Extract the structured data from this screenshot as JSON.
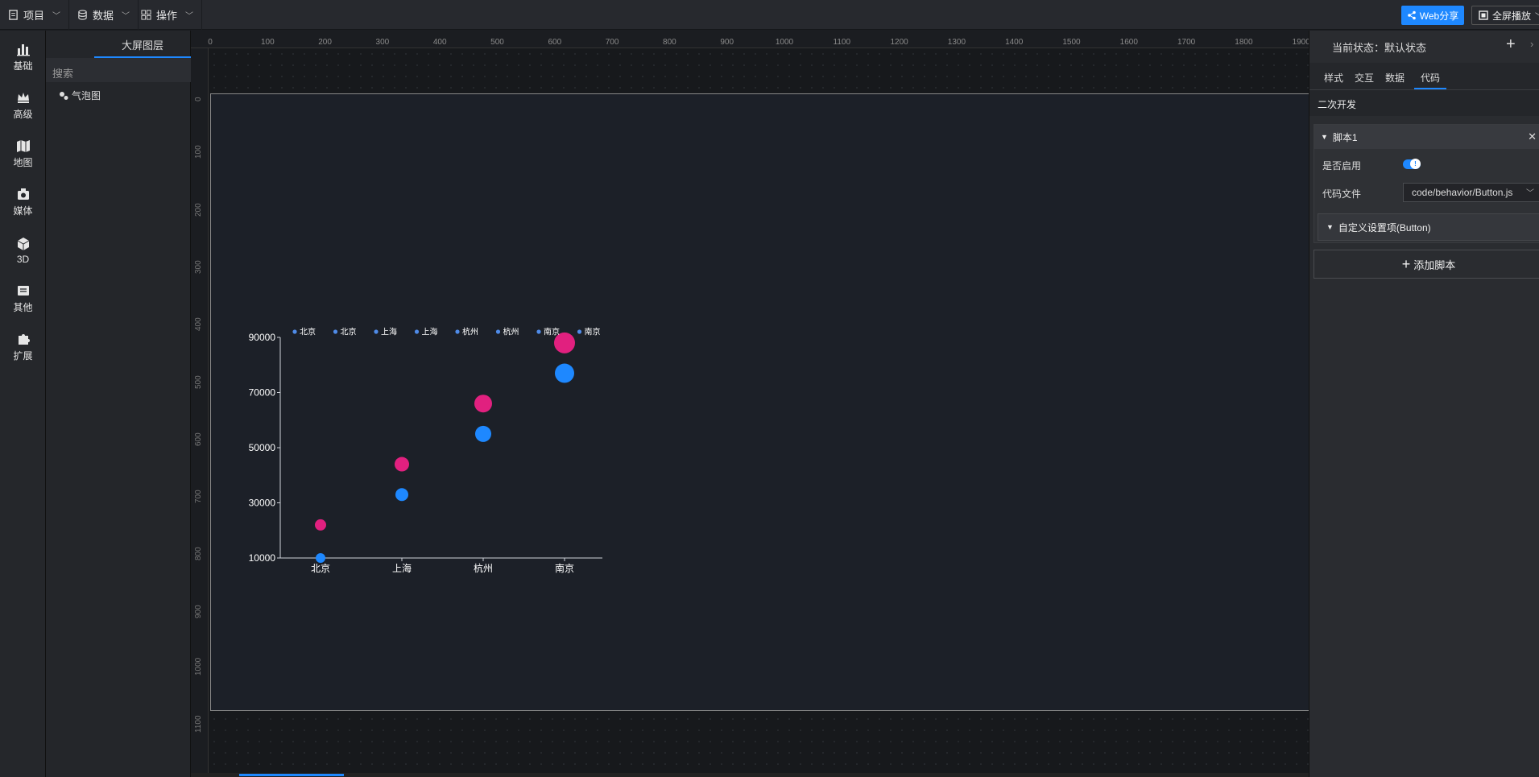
{
  "topbar": {
    "menus": [
      {
        "label": "项目",
        "icon": "document-icon"
      },
      {
        "label": "数据",
        "icon": "database-icon"
      },
      {
        "label": "操作",
        "icon": "grid-icon"
      }
    ],
    "web_share_label": "Web分享",
    "fullscreen_label": "全屏播放"
  },
  "leftnav": {
    "items": [
      {
        "label": "基础",
        "icon": "bar-chart-icon"
      },
      {
        "label": "高级",
        "icon": "crown-icon"
      },
      {
        "label": "地图",
        "icon": "map-icon"
      },
      {
        "label": "媒体",
        "icon": "camera-icon"
      },
      {
        "label": "3D",
        "icon": "cube-icon"
      },
      {
        "label": "其他",
        "icon": "layers-icon"
      },
      {
        "label": "扩展",
        "icon": "puzzle-icon"
      }
    ]
  },
  "layers": {
    "tab_label": "大屏图层",
    "search_placeholder": "搜索",
    "items": [
      {
        "label": "气泡图",
        "icon": "bubble-icon"
      }
    ]
  },
  "rulers": {
    "top": [
      "0",
      "100",
      "200",
      "300",
      "400",
      "500",
      "600",
      "700",
      "800",
      "900",
      "1000",
      "1100",
      "1200",
      "1300",
      "1400",
      "1500",
      "1600",
      "1700",
      "1800",
      "1900"
    ],
    "left": [
      "0",
      "100",
      "200",
      "300",
      "400",
      "500",
      "600",
      "700",
      "800",
      "900",
      "1000",
      "1100"
    ]
  },
  "right_panel": {
    "state_label": "当前状态：默认状态",
    "tabs": [
      "样式",
      "交互",
      "数据",
      "代码"
    ],
    "active_tab": "代码",
    "section_title": "二次开发",
    "script": {
      "title": "脚本1",
      "enabled_label": "是否启用",
      "enabled": true,
      "file_label": "代码文件",
      "file_value": "code/behavior/Button.js",
      "custom_settings_label": "自定义设置项(Button)"
    },
    "add_script_label": "添加脚本"
  },
  "chart_data": {
    "type": "scatter",
    "categories": [
      "北京",
      "上海",
      "杭州",
      "南京"
    ],
    "legend": [
      "北京",
      "北京",
      "上海",
      "上海",
      "杭州",
      "杭州",
      "南京",
      "南京"
    ],
    "legend_placement": "top",
    "y_ticks": [
      "10000",
      "30000",
      "50000",
      "70000",
      "90000"
    ],
    "ylim": [
      10000,
      90000
    ],
    "series": [
      {
        "color": "#1e88ff",
        "values": [
          10000,
          33000,
          55000,
          77000
        ],
        "sizes": [
          12,
          16,
          20,
          24
        ]
      },
      {
        "color": "#e1207f",
        "values": [
          22000,
          44000,
          66000,
          88000
        ],
        "sizes": [
          14,
          18,
          22,
          26
        ]
      }
    ]
  }
}
